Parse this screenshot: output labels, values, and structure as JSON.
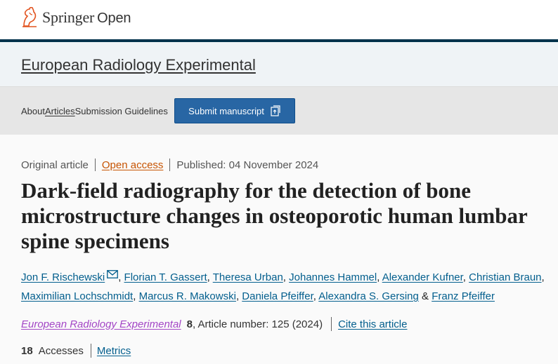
{
  "brand": {
    "name": "Springer",
    "suffix": "Open",
    "accent_color": "#e2531f",
    "header_border_color": "#01324b"
  },
  "journal": {
    "title": "European Radiology Experimental"
  },
  "nav": {
    "items": [
      "About",
      "Articles",
      "Submission Guidelines"
    ],
    "active": "Articles",
    "submit_label": "Submit manuscript",
    "submit_icon": "external-upload-icon",
    "submit_color": "#2866a4"
  },
  "article": {
    "type": "Original article",
    "access": "Open access",
    "published": "Published: 04 November 2024",
    "title": "Dark-field radiography for the detection of bone microstructure changes in osteoporotic human lumbar spine specimens",
    "authors": [
      "Jon F. Rischewski",
      "Florian T. Gassert",
      "Theresa Urban",
      "Johannes Hammel",
      "Alexander Kufner",
      "Christian Braun",
      "Maximilian Lochschmidt",
      "Marcus R. Makowski",
      "Daniela Pfeiffer",
      "Alexandra S. Gersing",
      "Franz Pfeiffer"
    ],
    "corresponding_icon": "mail-icon",
    "citation": {
      "journal": "European Radiology Experimental",
      "volume": "8",
      "article_number": ", Article number: 125 (2024)",
      "cite_label": "Cite this article"
    },
    "stats": {
      "accesses_count": "18",
      "accesses_label": "Accesses",
      "metrics_label": "Metrics"
    }
  }
}
